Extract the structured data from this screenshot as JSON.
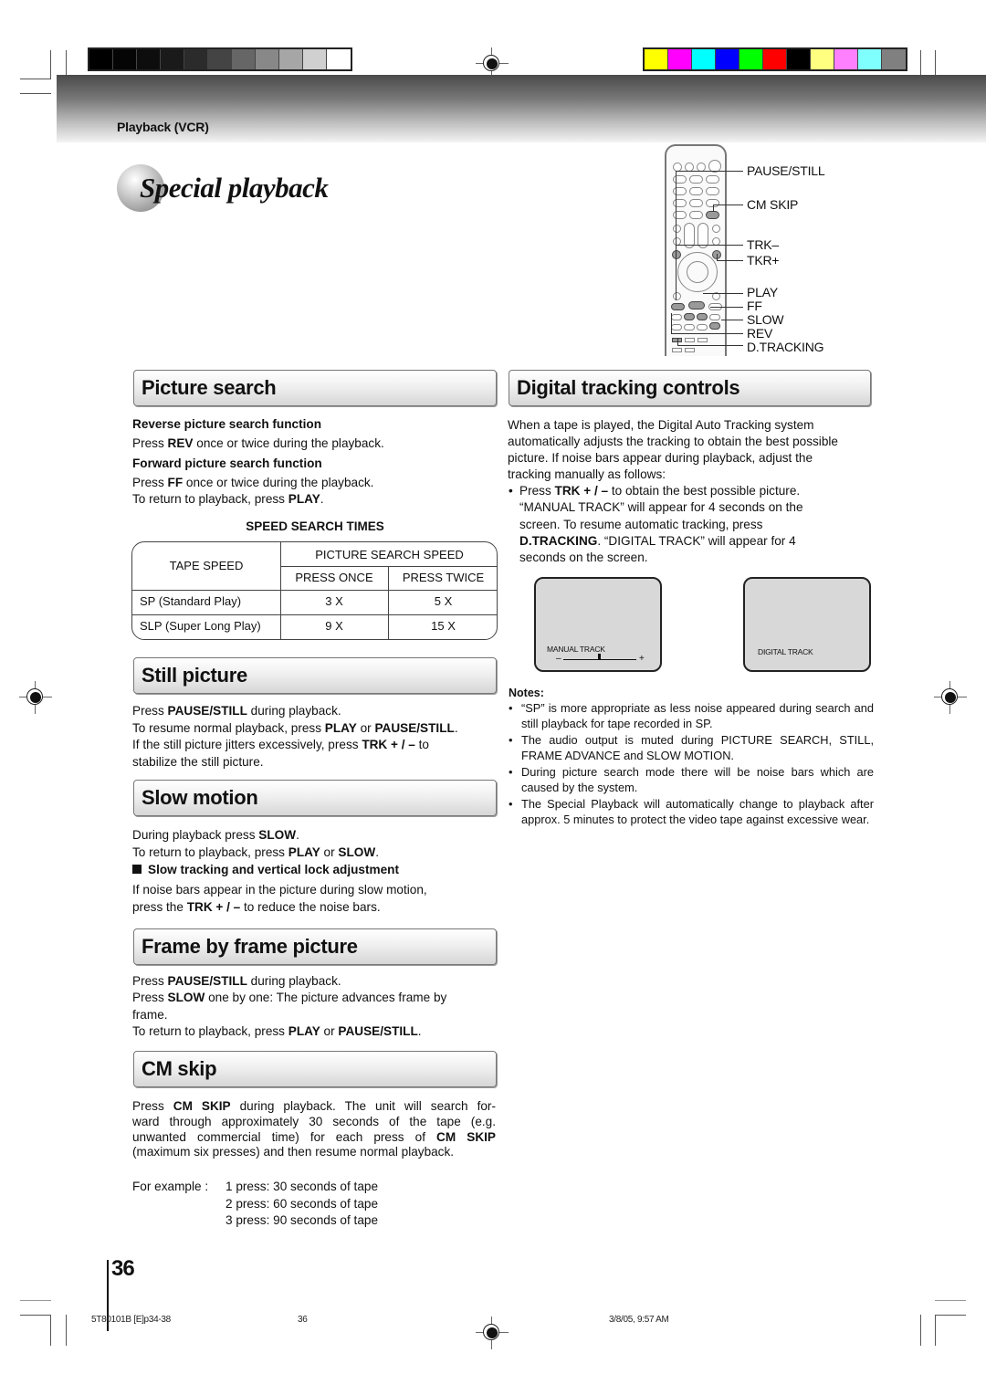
{
  "color_bars": {
    "grayscale": [
      "#000000",
      "#050505",
      "#0d0d0d",
      "#1a1a1a",
      "#2b2b2b",
      "#444444",
      "#666666",
      "#888888",
      "#a6a6a6",
      "#d0d0d0",
      "#ffffff"
    ],
    "colors": [
      "#ffff00",
      "#ff00ff",
      "#00ffff",
      "#0000ff",
      "#00ff00",
      "#ff0000",
      "#000000",
      "#ffff80",
      "#ff80ff",
      "#80ffff",
      "#808080"
    ]
  },
  "header": {
    "breadcrumb": "Playback (VCR)",
    "title": "Special playback"
  },
  "remote": {
    "labels": {
      "pause_still": "PAUSE/STILL",
      "cm_skip": "CM SKIP",
      "trk_minus": "TRK–",
      "trk_plus": "TKR+",
      "play": "PLAY",
      "ff": "FF",
      "slow": "SLOW",
      "rev": "REV",
      "d_tracking": "D.TRACKING"
    }
  },
  "picture_search": {
    "heading": "Picture search",
    "reverse_title": "Reverse picture search function",
    "reverse_pre": "Press ",
    "reverse_key": "REV",
    "reverse_post": " once or twice during the playback.",
    "forward_title": "Forward picture search function",
    "forward_pre": "Press ",
    "forward_key": "FF",
    "forward_post": " once or twice during the playback.",
    "return_pre": "To return to playback, press ",
    "return_key": "PLAY",
    "return_post": ".",
    "table": {
      "title": "SPEED SEARCH TIMES",
      "col_tape_speed": "TAPE SPEED",
      "col_group": "PICTURE SEARCH SPEED",
      "col_once": "PRESS ONCE",
      "col_twice": "PRESS TWICE",
      "rows": [
        {
          "tape": "SP (Standard Play)",
          "once": "3 X",
          "twice": "5 X"
        },
        {
          "tape": "SLP (Super Long Play)",
          "once": "9 X",
          "twice": "15 X"
        }
      ]
    }
  },
  "still_picture": {
    "heading": "Still picture",
    "l1_pre": "Press ",
    "l1_key": "PAUSE/STILL",
    "l1_post": " during playback.",
    "l2_pre": "To resume normal playback, press ",
    "l2_key1": "PLAY",
    "l2_mid": " or ",
    "l2_key2": "PAUSE/STILL",
    "l2_post": ".",
    "l3_pre": "If the still picture jitters excessively, press ",
    "l3_key": "TRK + / –",
    "l3_post": " to",
    "l4": "stabilize the still picture."
  },
  "slow_motion": {
    "heading": "Slow motion",
    "l1_pre": "During playback press ",
    "l1_key": "SLOW",
    "l1_post": ".",
    "l2_pre": "To return to playback, press ",
    "l2_key1": "PLAY",
    "l2_mid": " or ",
    "l2_key2": "SLOW",
    "l2_post": ".",
    "sub_heading": "Slow tracking and vertical lock adjustment",
    "l3": "If noise bars appear in the picture during slow motion,",
    "l4_pre": "press the ",
    "l4_key": "TRK + / –",
    "l4_post": " to reduce the noise bars."
  },
  "frame_by_frame": {
    "heading": "Frame by frame picture",
    "l1_pre": "Press ",
    "l1_key": "PAUSE/STILL",
    "l1_post": " during playback.",
    "l2_pre": "Press ",
    "l2_key": "SLOW",
    "l2_post": " one by one: The picture advances frame by",
    "l3": "frame.",
    "l4_pre": "To return to playback, press ",
    "l4_key1": "PLAY",
    "l4_mid": " or ",
    "l4_key2": "PAUSE/STILL",
    "l4_post": "."
  },
  "cm_skip": {
    "heading": "CM skip",
    "l1_pre": "Press ",
    "l1_key": "CM SKIP",
    "l1_post": " during playback. The unit will search for-",
    "l2": "ward through approximately 30 seconds of the tape (e.g.",
    "l3_pre": "unwanted commercial time) for each press of ",
    "l3_key": "CM SKIP",
    "l4": "(maximum six presses) and then resume normal playback.",
    "example_label": "For example  :",
    "examples": [
      "1 press: 30 seconds of tape",
      "2 press: 60 seconds of tape",
      "3 press: 90 seconds of tape"
    ]
  },
  "digital_tracking": {
    "heading": "Digital tracking controls",
    "intro": [
      "When a tape is played, the Digital Auto Tracking system",
      "automatically adjusts the tracking to obtain the best possible",
      "picture. If noise bars appear during playback, adjust the",
      "tracking manually as follows:"
    ],
    "b1_pre": "Press ",
    "b1_key": "TRK + / –",
    "b1_post": " to obtain the best possible picture.",
    "b2": "“MANUAL TRACK” will appear for 4 seconds on the",
    "b3": "screen. To resume automatic tracking, press",
    "b4_key": "D.TRACKING",
    "b4_post": ". “DIGITAL TRACK” will appear for 4",
    "b5": "seconds on the screen.",
    "screen_manual_label": "MANUAL  TRACK",
    "screen_manual_minus": "–",
    "screen_manual_plus": "+",
    "screen_digital_label": "DIGITAL TRACK"
  },
  "notes": {
    "title": "Notes:",
    "items": [
      "“SP” is more appropriate as less noise appeared during search and still playback for tape recorded in SP.",
      "The audio output is muted during PICTURE SEARCH, STILL, FRAME ADVANCE and SLOW MOTION.",
      "During picture search mode there will be noise bars which are caused by the system.",
      "The Special Playback will automatically change to playback after approx. 5 minutes to protect the video tape against excessive wear."
    ]
  },
  "footer": {
    "page_number": "36",
    "file_ref": "5T80101B [E]p34-38",
    "page_ref": "36",
    "timestamp": "3/8/05, 9:57 AM"
  }
}
